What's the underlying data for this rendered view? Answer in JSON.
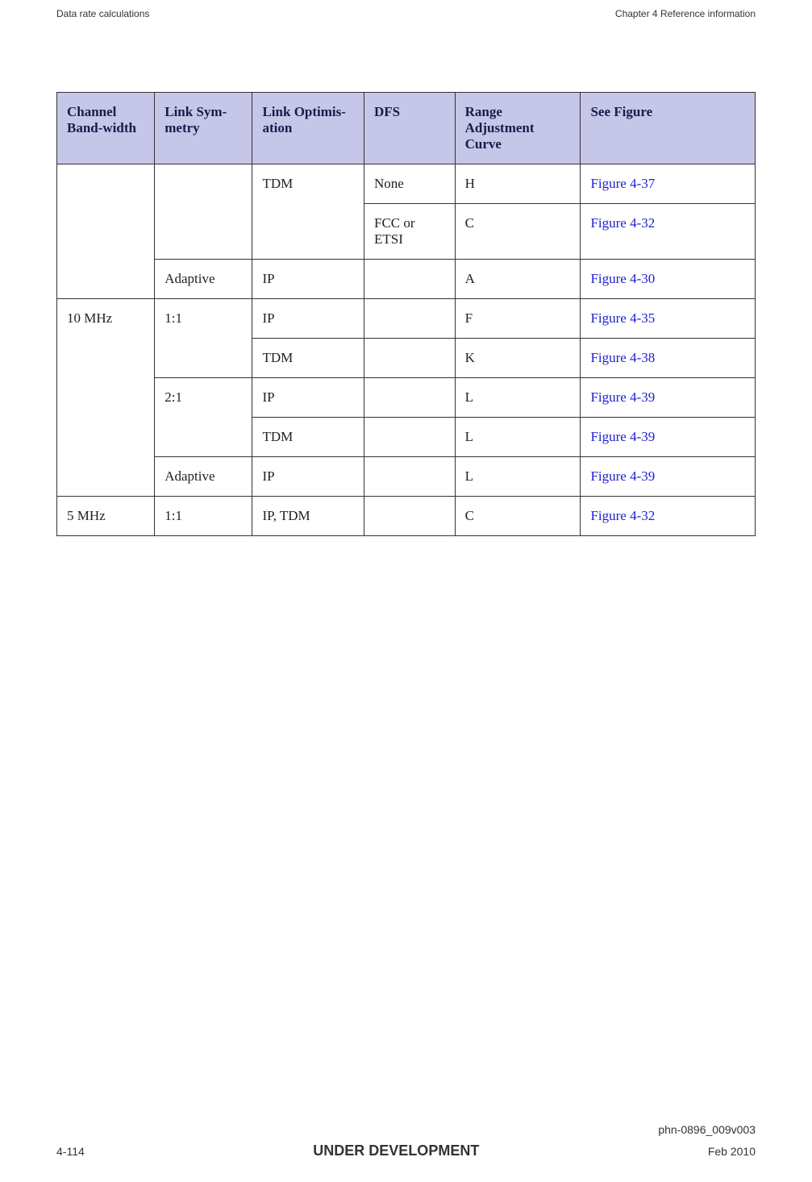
{
  "header": {
    "left": "Data rate calculations",
    "right": "Chapter 4 Reference information"
  },
  "table": {
    "headers": {
      "col1": "Channel Band-width",
      "col2": "Link Sym-metry",
      "col3": "Link Optimis-ation",
      "col4": "DFS",
      "col5": "Range Adjustment Curve",
      "col6": "See Figure"
    },
    "rows": [
      {
        "c1": "",
        "c2": "",
        "c3": "TDM",
        "c4": "None",
        "c5": "H",
        "c6": "Figure 4-37"
      },
      {
        "c1": "",
        "c2": "",
        "c3": "",
        "c4": "FCC or ETSI",
        "c5": "C",
        "c6": "Figure 4-32"
      },
      {
        "c1": "",
        "c2": "Adaptive",
        "c3": "IP",
        "c4": "",
        "c5": "A",
        "c6": "Figure 4-30"
      },
      {
        "c1": "10 MHz",
        "c2": "1:1",
        "c3": "IP",
        "c4": "",
        "c5": "F",
        "c6": "Figure 4-35"
      },
      {
        "c1": "",
        "c2": "",
        "c3": "TDM",
        "c4": "",
        "c5": "K",
        "c6": "Figure 4-38"
      },
      {
        "c1": "",
        "c2": "2:1",
        "c3": "IP",
        "c4": "",
        "c5": "L",
        "c6": "Figure 4-39"
      },
      {
        "c1": "",
        "c2": "",
        "c3": "TDM",
        "c4": "",
        "c5": "L",
        "c6": "Figure 4-39"
      },
      {
        "c1": "",
        "c2": "Adaptive",
        "c3": "IP",
        "c4": "",
        "c5": "L",
        "c6": "Figure 4-39"
      },
      {
        "c1": "5 MHz",
        "c2": "1:1",
        "c3": "IP, TDM",
        "c4": "",
        "c5": "C",
        "c6": "Figure 4-32"
      }
    ]
  },
  "footer": {
    "docId": "phn-0896_009v003",
    "pageNum": "4-114",
    "status": "UNDER DEVELOPMENT",
    "date": "Feb 2010"
  }
}
